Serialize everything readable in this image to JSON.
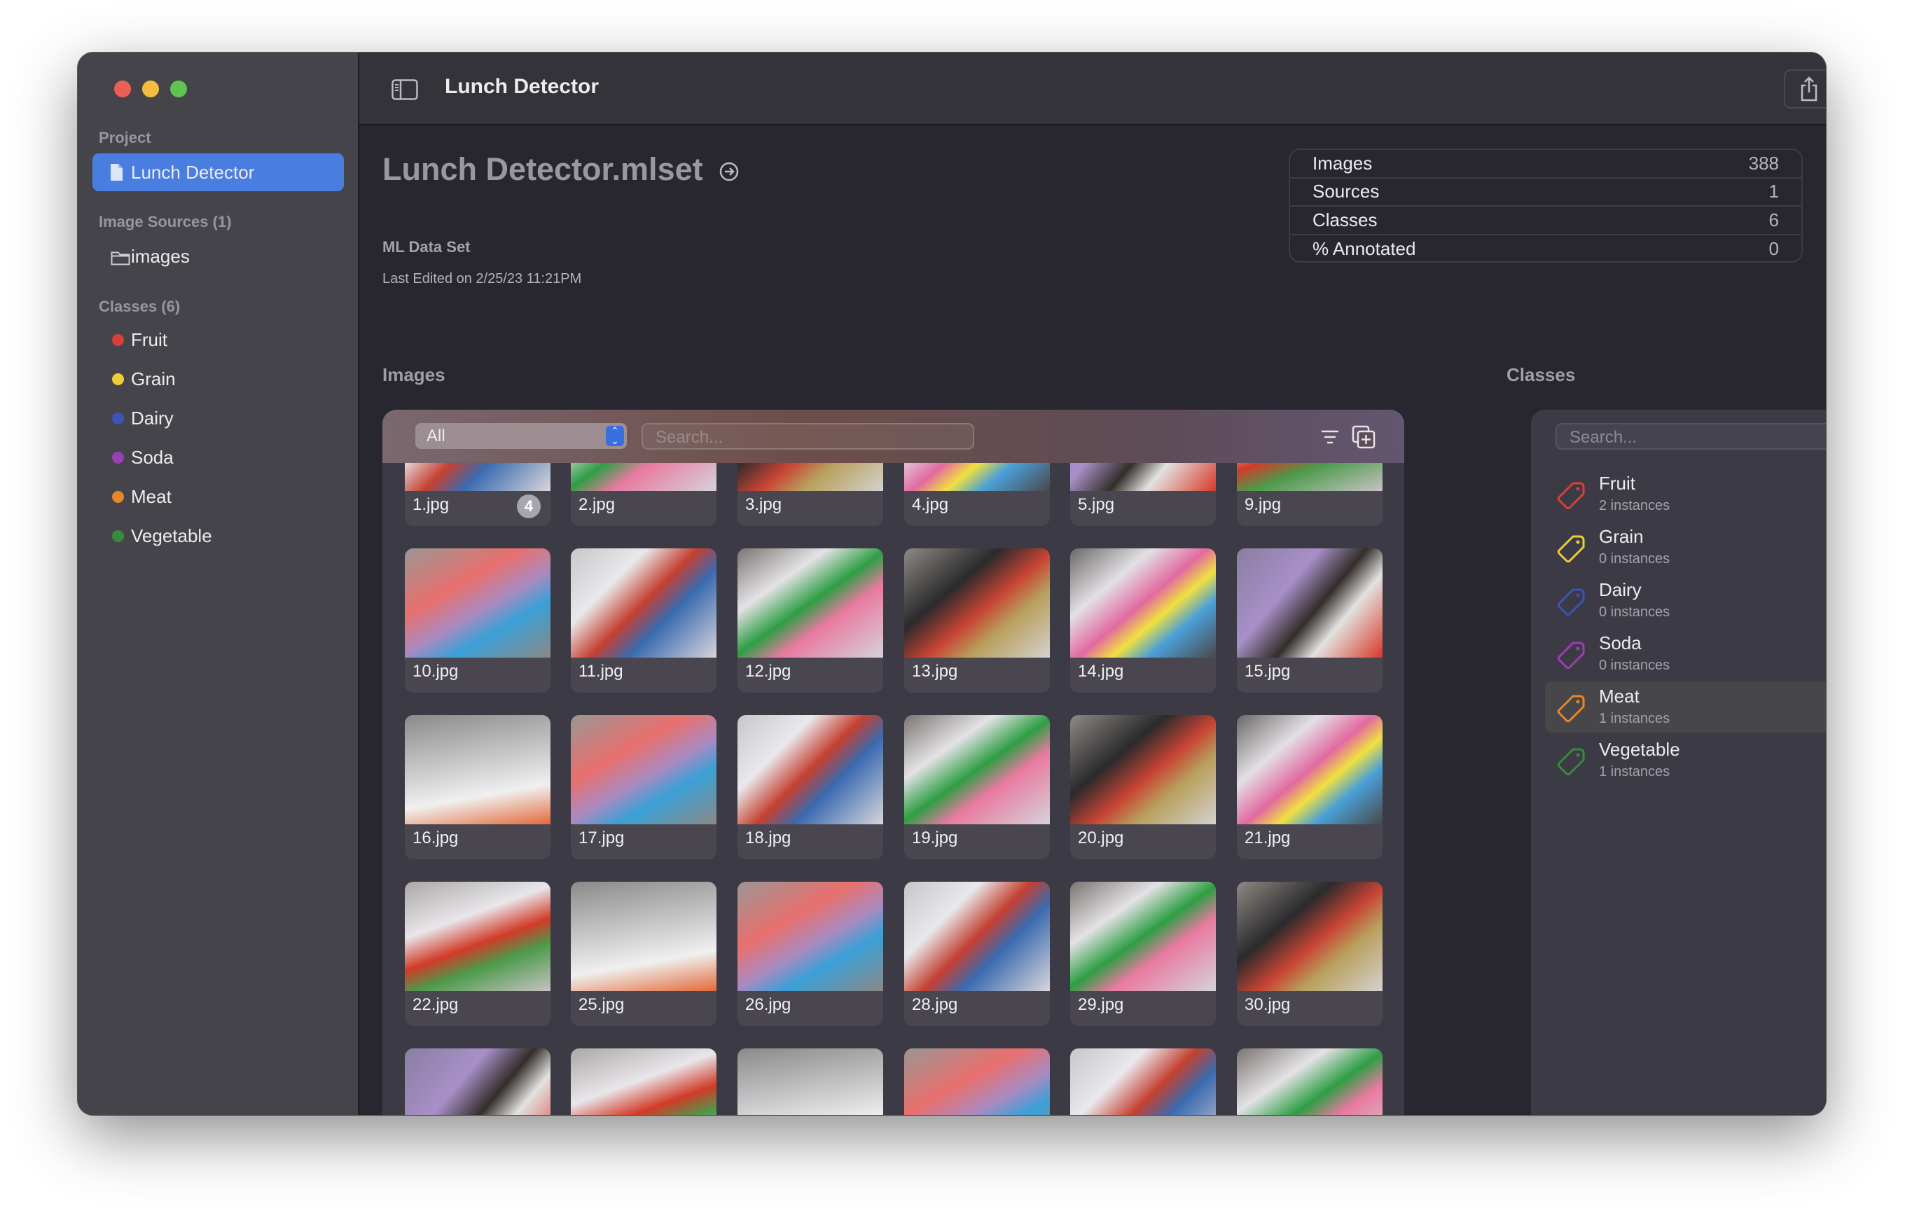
{
  "window": {
    "title": "Lunch Detector"
  },
  "sidebar": {
    "project_header": "Project",
    "project_item": "Lunch Detector",
    "sources_header": "Image Sources (1)",
    "sources": [
      "images"
    ],
    "classes_header": "Classes (6)",
    "classes": [
      {
        "label": "Fruit",
        "color": "#d8413a"
      },
      {
        "label": "Grain",
        "color": "#f0cc35"
      },
      {
        "label": "Dairy",
        "color": "#3a56b4"
      },
      {
        "label": "Soda",
        "color": "#9b3fb4"
      },
      {
        "label": "Meat",
        "color": "#e8862a"
      },
      {
        "label": "Vegetable",
        "color": "#3a8a3e"
      }
    ]
  },
  "header": {
    "title": "Lunch Detector.mlset",
    "subtitle": "ML Data Set",
    "last_edited": "Last Edited on 2/25/23 11:21PM"
  },
  "stats": [
    {
      "label": "Images",
      "value": "388"
    },
    {
      "label": "Sources",
      "value": "1"
    },
    {
      "label": "Classes",
      "value": "6"
    },
    {
      "label": "% Annotated",
      "value": "0"
    }
  ],
  "images_panel": {
    "heading": "Images",
    "filter_value": "All",
    "search_placeholder": "Search...",
    "rows": [
      [
        {
          "name": "1.jpg",
          "badge": "4"
        },
        {
          "name": "2.jpg"
        },
        {
          "name": "3.jpg"
        },
        {
          "name": "4.jpg"
        },
        {
          "name": "5.jpg"
        },
        {
          "name": "9.jpg"
        }
      ],
      [
        {
          "name": "10.jpg"
        },
        {
          "name": "11.jpg"
        },
        {
          "name": "12.jpg"
        },
        {
          "name": "13.jpg"
        },
        {
          "name": "14.jpg"
        },
        {
          "name": "15.jpg"
        }
      ],
      [
        {
          "name": "16.jpg"
        },
        {
          "name": "17.jpg"
        },
        {
          "name": "18.jpg"
        },
        {
          "name": "19.jpg"
        },
        {
          "name": "20.jpg"
        },
        {
          "name": "21.jpg"
        }
      ],
      [
        {
          "name": "22.jpg"
        },
        {
          "name": "25.jpg"
        },
        {
          "name": "26.jpg"
        },
        {
          "name": "28.jpg"
        },
        {
          "name": "29.jpg"
        },
        {
          "name": "30.jpg"
        }
      ],
      [
        {},
        {},
        {},
        {},
        {},
        {}
      ]
    ]
  },
  "classes_panel": {
    "heading": "Classes",
    "search_placeholder": "Search...",
    "selected_index": 4,
    "items": [
      {
        "name": "Fruit",
        "count": "2 instances",
        "color": "#d8413a"
      },
      {
        "name": "Grain",
        "count": "0 instances",
        "color": "#f0cc35"
      },
      {
        "name": "Dairy",
        "count": "0 instances",
        "color": "#3a56b4"
      },
      {
        "name": "Soda",
        "count": "0 instances",
        "color": "#9b3fb4"
      },
      {
        "name": "Meat",
        "count": "1 instances",
        "color": "#e8862a"
      },
      {
        "name": "Vegetable",
        "count": "1 instances",
        "color": "#3a8a3e"
      }
    ]
  }
}
